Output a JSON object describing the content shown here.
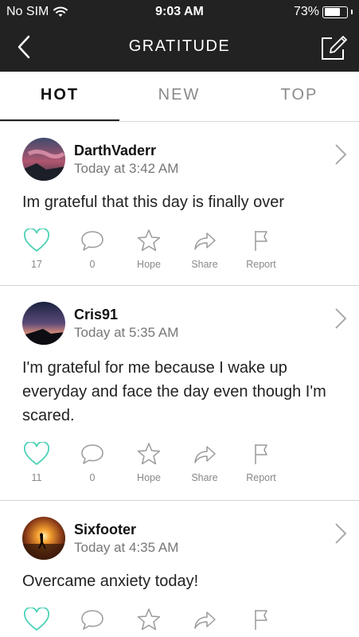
{
  "status_bar": {
    "carrier": "No SIM",
    "time": "9:03 AM",
    "battery_percent": "73%",
    "battery_level": 0.73
  },
  "nav": {
    "title": "GRATITUDE"
  },
  "tabs": [
    {
      "label": "HOT",
      "active": true
    },
    {
      "label": "NEW",
      "active": false
    },
    {
      "label": "TOP",
      "active": false
    }
  ],
  "action_labels": {
    "hope": "Hope",
    "share": "Share",
    "report": "Report"
  },
  "posts": [
    {
      "username": "DarthVaderr",
      "time": "Today at 3:42 AM",
      "text": "Im grateful that this day is finally over",
      "likes": "17",
      "comments": "0"
    },
    {
      "username": "Cris91",
      "time": "Today at 5:35 AM",
      "text": "I'm grateful for me because I wake up everyday and face the day even though I'm scared.",
      "likes": "11",
      "comments": "0"
    },
    {
      "username": "Sixfooter",
      "time": "Today at 4:35 AM",
      "text": "Overcame anxiety today!",
      "likes": "",
      "comments": ""
    }
  ],
  "colors": {
    "header_bg": "#222222",
    "like_accent": "#4cd1b5",
    "icon_gray": "#9a9a9a"
  }
}
